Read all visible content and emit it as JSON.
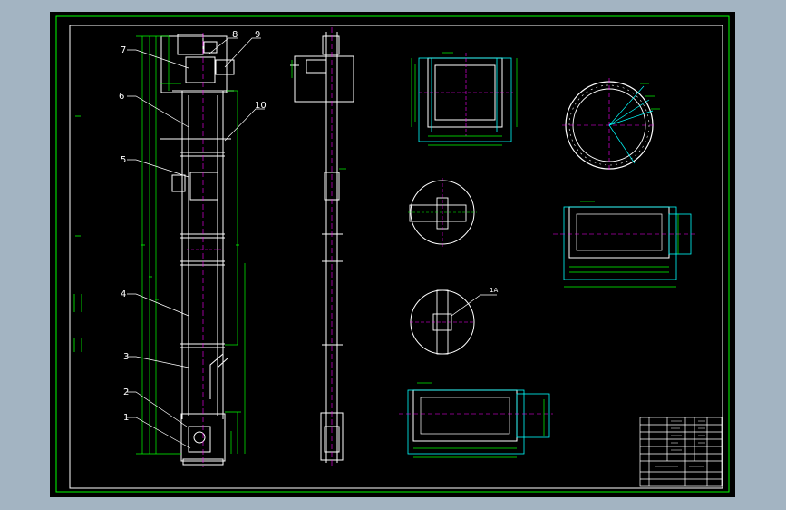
{
  "colors": {
    "frame_bg": "#a3b4c2",
    "sheet": "#000000",
    "border": "#00ff00",
    "outline": "#ffffff",
    "dim": "#00ff00",
    "accent": "#00ffff",
    "hidden": "#ff00ff"
  },
  "callouts": [
    {
      "id": "1",
      "label": "1"
    },
    {
      "id": "2",
      "label": "2"
    },
    {
      "id": "3",
      "label": "3"
    },
    {
      "id": "4",
      "label": "4"
    },
    {
      "id": "5",
      "label": "5"
    },
    {
      "id": "6",
      "label": "6"
    },
    {
      "id": "7",
      "label": "7"
    },
    {
      "id": "8",
      "label": "8"
    },
    {
      "id": "9",
      "label": "9"
    },
    {
      "id": "10",
      "label": "10"
    }
  ],
  "detail_label": "1A",
  "icons": {
    "drawing": "cad-drawing-icon"
  }
}
